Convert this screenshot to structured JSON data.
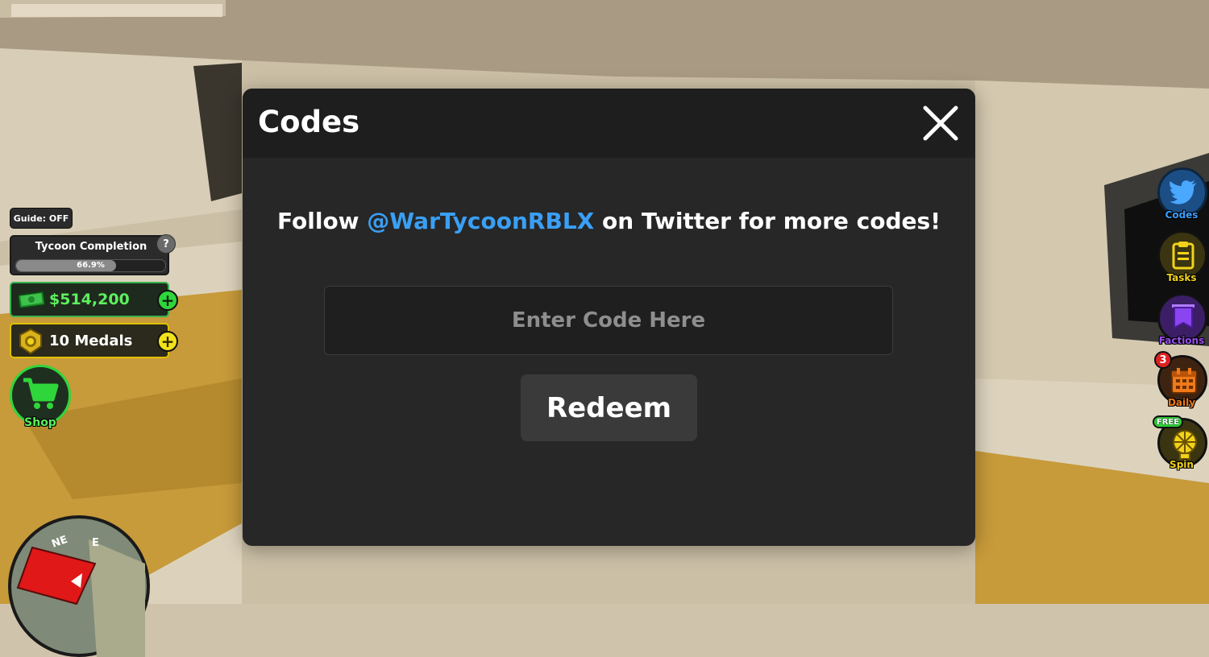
{
  "hud": {
    "guide_label": "Guide: OFF",
    "tycoon_title": "Tycoon Completion",
    "tycoon_progress_percent": 66.9,
    "tycoon_progress_text": "66.9%",
    "help_label": "?",
    "money": "$514,200",
    "medals": "10 Medals",
    "plus_label": "+",
    "shop_label": "Shop",
    "compass_labels": [
      "NE",
      "E"
    ]
  },
  "side_buttons": [
    {
      "label": "Codes",
      "icon": "twitter-bird-icon",
      "color": "#2f8fe6",
      "label_color": "#3aa0ff"
    },
    {
      "label": "Tasks",
      "icon": "clipboard-icon",
      "color": "#f2d21b",
      "label_color": "#f2d21b"
    },
    {
      "label": "Factions",
      "icon": "banner-icon",
      "color": "#7a2fd8",
      "label_color": "#9a4ff0"
    },
    {
      "label": "Daily",
      "icon": "calendar-icon",
      "color": "#f07a1a",
      "label_color": "#f07a1a",
      "badge": "3"
    },
    {
      "label": "Spin",
      "icon": "wheel-icon",
      "color": "#f2d21b",
      "label_color": "#f2d21b",
      "badge": "FREE"
    }
  ],
  "dialog": {
    "title": "Codes",
    "follow_prefix": "Follow ",
    "follow_handle": "@WarTycoonRBLX",
    "follow_suffix": " on Twitter for more codes!",
    "input_placeholder": "Enter Code Here",
    "input_value": "",
    "redeem_label": "Redeem"
  },
  "colors": {
    "dialog_bg": "#272727",
    "header_bg": "#1e1e1e",
    "handle_blue": "#3a9ff5",
    "money_green": "#5df05d",
    "medal_yellow": "#f2e21b"
  }
}
